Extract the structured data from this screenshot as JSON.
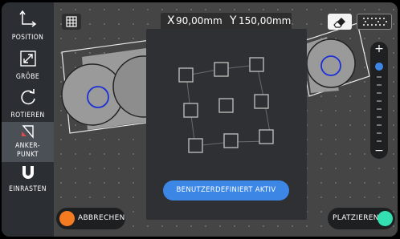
{
  "sidebar": {
    "items": [
      {
        "label": "POSITION",
        "icon": "move-arrows-icon"
      },
      {
        "label": "GRÖBE",
        "icon": "resize-icon"
      },
      {
        "label": "ROTIEREN",
        "icon": "rotate-icon"
      },
      {
        "label_line1": "ANKER-",
        "label_line2": "PUNKT",
        "icon": "anchor-point-icon"
      },
      {
        "label": "EINRASTEN",
        "icon": "magnet-icon"
      }
    ]
  },
  "toolbar": {
    "x_prefix": "X",
    "x_value": "90,00mm",
    "y_prefix": "Y",
    "y_value": "150,00mm"
  },
  "panel": {
    "button_label": "BENUTZERDEFINIERT AKTIV"
  },
  "zoom": {
    "plus": "+",
    "minus": "−"
  },
  "actions": {
    "cancel_label": "ABBRECHEN",
    "place_label": "PLATZIEREN"
  },
  "colors": {
    "sidebar_bg": "#2b2f34",
    "accent_blue": "#3c87e6",
    "cancel_orange": "#f47b20",
    "place_teal": "#34e0b1",
    "anchor_red": "#e24b4b"
  }
}
